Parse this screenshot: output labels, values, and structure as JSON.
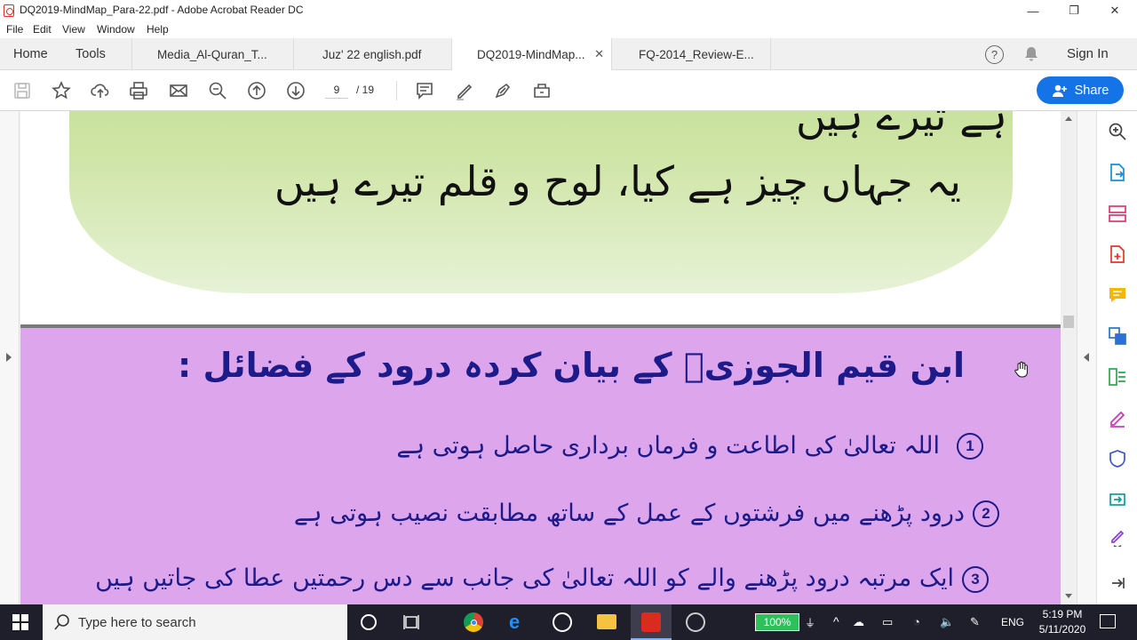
{
  "window": {
    "title": "DQ2019-MindMap_Para-22.pdf - Adobe Acrobat Reader DC",
    "minimize": "—",
    "restore": "❐",
    "close": "✕"
  },
  "menu": [
    "File",
    "Edit",
    "View",
    "Window",
    "Help"
  ],
  "nav_tabs": [
    "Home",
    "Tools"
  ],
  "doc_tabs": [
    {
      "label": "Media_Al-Quran_T..."
    },
    {
      "label": "Juz' 22 english.pdf"
    },
    {
      "label": "DQ2019-MindMap..."
    },
    {
      "label": "FQ-2014_Review-E..."
    }
  ],
  "header_right": {
    "help": "?",
    "sign_in": "Sign In"
  },
  "toolbar": {
    "page_current": "9",
    "page_total": "/ 19",
    "share_label": "Share"
  },
  "document": {
    "top_line_partial": "ہے تیرے ہیں",
    "green_line": "یہ جہاں چیز ہے کیا، لوح و قلم تیرے ہیں",
    "heading": "ابن قیم الجوزیؒ کے بیان کردہ درود کے فضائل :",
    "items": [
      {
        "num": "1",
        "text": "اللہ تعالیٰ کی اطاعت و فرماں برداری حاصل ہوتی ہے"
      },
      {
        "num": "2",
        "text": "درود پڑھنے میں فرشتوں کے عمل کے ساتھ مطابقت نصیب ہوتی ہے"
      },
      {
        "num": "3",
        "text": "ایک مرتبہ درود پڑھنے والے کو اللہ تعالیٰ کی جانب سے دس رحمتیں عطا کی جاتیں ہیں"
      }
    ]
  },
  "taskbar": {
    "search_placeholder": "Type here to search",
    "battery": "100%",
    "language": "ENG",
    "time": "5:19 PM",
    "date": "5/11/2020"
  }
}
